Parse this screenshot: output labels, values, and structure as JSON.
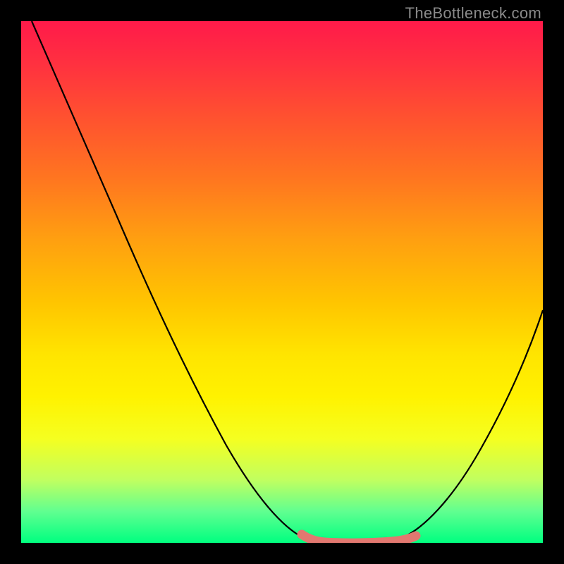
{
  "watermark": "TheBottleneck.com",
  "chart_data": {
    "type": "line",
    "title": "",
    "xlabel": "",
    "ylabel": "",
    "xlim": [
      0,
      100
    ],
    "ylim": [
      0,
      100
    ],
    "x": [
      0,
      5,
      10,
      15,
      20,
      25,
      30,
      35,
      40,
      45,
      50,
      55,
      58,
      60,
      63,
      65,
      70,
      75,
      80,
      85,
      90,
      95,
      100
    ],
    "values": [
      100,
      93,
      86,
      78,
      70,
      62,
      53,
      44,
      35,
      26,
      17,
      8,
      3,
      1,
      0,
      0,
      0,
      1,
      4,
      12,
      23,
      35,
      48
    ],
    "highlight_segment": {
      "x_start": 55,
      "x_end": 76,
      "y": 0
    }
  },
  "colors": {
    "curve": "#000000",
    "highlight": "#e27870",
    "background_top": "#ff1a4a",
    "background_bottom": "#00ff80"
  }
}
